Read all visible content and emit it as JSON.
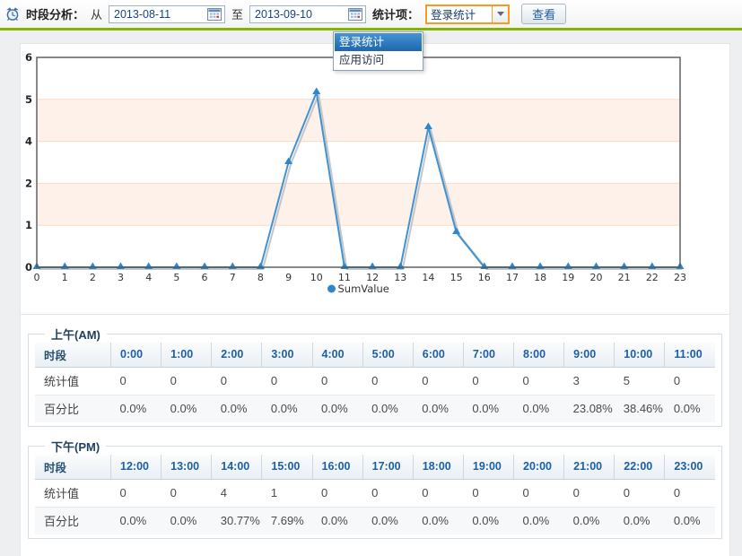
{
  "toolbar": {
    "title": "时段分析：",
    "from_label": "从",
    "from_value": "2013-08-11",
    "to_label": "至",
    "to_value": "2013-09-10",
    "stat_item_label": "统计项：",
    "stat_item_value": "登录统计",
    "view_button": "查看",
    "dropdown_options": [
      {
        "label": "登录统计",
        "selected": true
      },
      {
        "label": "应用访问",
        "selected": false
      }
    ]
  },
  "colors": {
    "accent_green": "#86b300",
    "line_blue": "#3f93d4",
    "marker_blue": "#2f87c9",
    "shadow_gray": "#c6c6c6",
    "band_pink": "#fdf1e9",
    "band_edge_pink": "#f8dbc5",
    "axis_gray": "#565656",
    "header_blue": "#1b5fa8",
    "date_text_blue": "#15428b",
    "select_border_orange": "#f59b22"
  },
  "chart_data": {
    "type": "line",
    "x": [
      0,
      1,
      2,
      3,
      4,
      5,
      6,
      7,
      8,
      9,
      10,
      11,
      12,
      13,
      14,
      15,
      16,
      17,
      18,
      19,
      20,
      21,
      22,
      23
    ],
    "series": [
      {
        "name": "SumValue",
        "values": [
          0,
          0,
          0,
          0,
          0,
          0,
          0,
          0,
          0,
          3,
          5,
          0,
          0,
          0,
          4,
          1,
          0,
          0,
          0,
          0,
          0,
          0,
          0,
          0
        ]
      }
    ],
    "title": "",
    "xlabel": "",
    "ylabel": "",
    "ylim": [
      0,
      6
    ],
    "y_ticks": [
      {
        "value": 0,
        "label": "0"
      },
      {
        "value": 1.2,
        "label": "1"
      },
      {
        "value": 2.4,
        "label": "2"
      },
      {
        "value": 3.6,
        "label": "4"
      },
      {
        "value": 4.8,
        "label": "5"
      },
      {
        "value": 6,
        "label": "6"
      }
    ],
    "pink_bands": [
      [
        1.2,
        2.4
      ],
      [
        3.6,
        4.8
      ]
    ],
    "legend": "SumValue",
    "legend_position": "bottom-center",
    "grid": "bands"
  },
  "tables": {
    "am": {
      "title": "上午(AM)",
      "header_label": "时段",
      "columns": [
        "0:00",
        "1:00",
        "2:00",
        "3:00",
        "4:00",
        "5:00",
        "6:00",
        "7:00",
        "8:00",
        "9:00",
        "10:00",
        "11:00"
      ],
      "rows": [
        {
          "label": "统计值",
          "values": [
            "0",
            "0",
            "0",
            "0",
            "0",
            "0",
            "0",
            "0",
            "0",
            "3",
            "5",
            "0"
          ]
        },
        {
          "label": "百分比",
          "values": [
            "0.0%",
            "0.0%",
            "0.0%",
            "0.0%",
            "0.0%",
            "0.0%",
            "0.0%",
            "0.0%",
            "0.0%",
            "23.08%",
            "38.46%",
            "0.0%"
          ]
        }
      ]
    },
    "pm": {
      "title": "下午(PM)",
      "header_label": "时段",
      "columns": [
        "12:00",
        "13:00",
        "14:00",
        "15:00",
        "16:00",
        "17:00",
        "18:00",
        "19:00",
        "20:00",
        "21:00",
        "22:00",
        "23:00"
      ],
      "rows": [
        {
          "label": "统计值",
          "values": [
            "0",
            "0",
            "4",
            "1",
            "0",
            "0",
            "0",
            "0",
            "0",
            "0",
            "0",
            "0"
          ]
        },
        {
          "label": "百分比",
          "values": [
            "0.0%",
            "0.0%",
            "30.77%",
            "7.69%",
            "0.0%",
            "0.0%",
            "0.0%",
            "0.0%",
            "0.0%",
            "0.0%",
            "0.0%",
            "0.0%"
          ]
        }
      ]
    }
  }
}
